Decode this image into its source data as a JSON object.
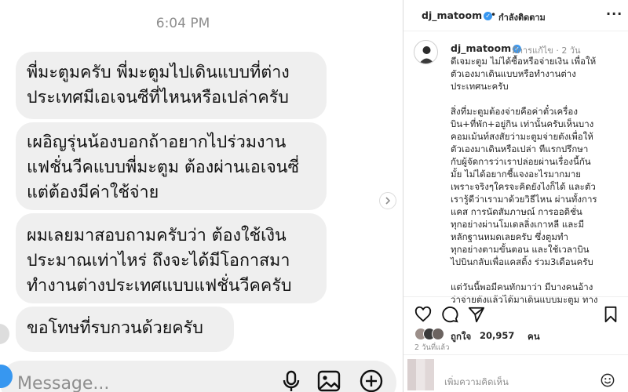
{
  "chat": {
    "time": "6:04 PM",
    "messages": [
      {
        "lines": [
          "พี่มะตูมครับ พี่มะตูมไปเดินแบบที่ต่าง",
          "ประเทศมีเอเจนซีที่ไหนหรือเปล่าครับ"
        ]
      },
      {
        "lines": [
          "เผอิญรุ่นน้องบอกถ้าอยากไปร่วมงาน",
          "แฟชั่นวีคแบบพี่มะตูม ต้องผ่านเอเจนซี่",
          "แต่ต้องมีค่าใช้จ่าย"
        ]
      },
      {
        "lines": [
          "ผมเลยมาสอบถามครับว่า ต้องใช้เงิน",
          "ประมาณเท่าไหร่ ถึงจะได้มีโอกาสมา",
          "ทำงานต่างประเทศแบบแฟชั่นวีคครับ"
        ]
      },
      {
        "lines": [
          "ขอโทษที่รบกวนด้วยครับ"
        ]
      }
    ],
    "composer": {
      "placeholder": "Message...",
      "icons": [
        "microphone-icon",
        "image-icon",
        "add-circle-icon"
      ]
    }
  },
  "post": {
    "header": {
      "username": "dj_matoom",
      "follow_label": "กำลังติดตาม"
    },
    "caption": {
      "username": "dj_matoom",
      "edited_label": "มีการแก้ไข",
      "age": "2 วัน",
      "paragraphs": [
        [
          "ดีเจมะตูม ไม่ได้ซื้อหรือจ่ายเงิน เพื่อให้",
          "ตัวเองมาเดินแบบหรือทำงานต่าง",
          "ประเทศนะครับ"
        ],
        [
          "สิ่งที่มะตูมต้องจ่ายคือค่าตั๋วเครื่อง",
          "บิน+ที่พัก+อยู่กิน เท่านั้นครับเห็นบาง",
          "คอมเม้นท์สงสัยว่ามะตูมจ่ายตังเพื่อให้",
          "ตัวเองมาเดินหรือเปล่า ทีแรกปรึกษา",
          "กับผู้จัดการว่าเราปล่อยผ่านเรื่องนี้กัน",
          "มั้ย ไม่ได้อยากชี้แจงอะไรมากมาย",
          "เพราะจริงๆใครจะคิดยังไงก็ได้ และตัว",
          "เรารู้ดีว่าเรามาด้วยวิธีไหน ผ่านทั้งการ",
          "แคส การนัดสัมภาษณ์ การออดิชั่น",
          "ทุกอย่างผ่านโมเดลลิ่งเกาหลี และมี",
          "หลักฐานหมดเลยครับ ซึ่งตูมทำ",
          "ทุกอย่างตามขั้นตอน และใช้เวลาบิน",
          "ไปบินกลับเพื่อแคสติ้ง ร่วม3เดือนครับ"
        ],
        [
          "แต่วันนี้พอมีคนทักมาว่า มีบางคนอ้าง",
          "ว่าจ่ายตังแล้วได้มาเดินแบบมะตูม ทาง"
        ]
      ]
    },
    "actions": [
      "heart-icon",
      "comment-icon",
      "share-icon",
      "bookmark-icon"
    ],
    "likes": {
      "label": "ถูกใจ",
      "count": "20,957",
      "unit": "คน"
    },
    "age_label": "2 วันที่แล้ว",
    "comment_placeholder": "เพิ่มความคิดเห็น",
    "colors": {
      "verified": "#3897f0",
      "bubble": "#efefef",
      "muted": "#8e8e8e"
    }
  }
}
